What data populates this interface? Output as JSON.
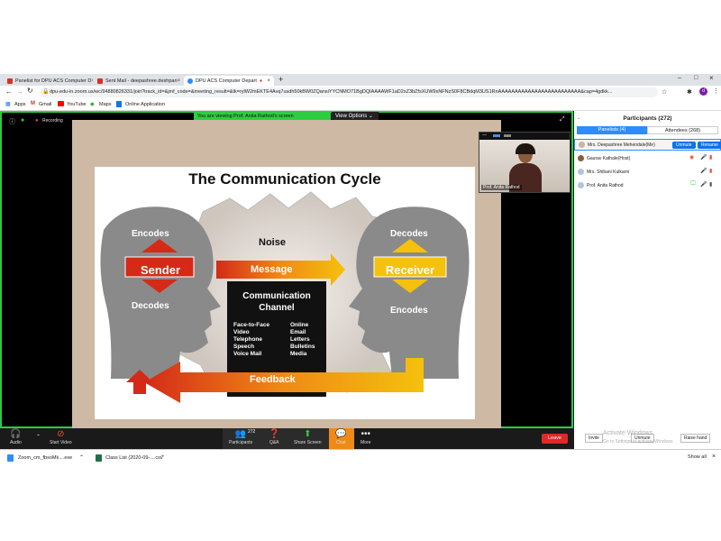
{
  "browser": {
    "tabs": [
      {
        "label": "Panelist for DPU ACS Computer D",
        "color": "#d93025"
      },
      {
        "label": "Sent Mail - deepashree.deshpan",
        "color": "#d93025"
      },
      {
        "label": "DPU ACS Computer Depart",
        "color": "#2d8cff"
      }
    ],
    "url": "dpu-edu-in.zoom.us/wc/94880826331/join?track_id=&jmf_code=&meeting_result=&tk=rylW2mEKTE4Avq7usdh50kBW0ZQansiYYCNMO71BgDQIAAAAWF1aD2xZ3bZfsXUW9sNFNzS0F8CBdqM3US1RnAAAAAAAAAAAAAAAAAAAAAAAAA&cap=4gdkk...",
    "bookmarks": [
      "Apps",
      "Gmail",
      "YouTube",
      "Maps",
      "Online Application"
    ]
  },
  "zoom": {
    "banner": "You are viewing Prof. Anita Rathod's screen",
    "view_options": "View Options",
    "recording": "Recording",
    "speaker_name": "Prof. Anita Rathod",
    "toolbar": {
      "audio": "Audio",
      "stop_video": "Start Video",
      "participants": "Participants",
      "participants_count": "272",
      "qa": "Q&A",
      "share_screen": "Share Screen",
      "chat": "Chat",
      "more": "More",
      "leave": "Leave"
    },
    "panel": {
      "title": "Participants (272)",
      "tab_panelists": "Panelists (4)",
      "tab_attendees": "Attendees (268)",
      "people": [
        {
          "name": "Mrs. Deepashree Mehendale(Me)"
        },
        {
          "name": "Gaurav Kathale(Host)"
        },
        {
          "name": "Mrs. Shibani Kulkarni"
        },
        {
          "name": "Prof. Anita Rathod"
        }
      ],
      "unmute": "Unmute",
      "rename": "Rename",
      "invite": "Invite",
      "unmute_all": "Unmute",
      "raise_hand": "Raise hand",
      "activate_windows": "Activate Windows",
      "activate_sub": "Go to Settings to activate Windows."
    }
  },
  "slide": {
    "title": "The Communication Cycle",
    "noise": "Noise",
    "message": "Message",
    "sender": "Sender",
    "receiver": "Receiver",
    "encodes_left": "Encodes",
    "decodes_left": "Decodes",
    "decodes_right": "Decodes",
    "encodes_right": "Encodes",
    "channel_title": "Communication Channel",
    "channel_col1": [
      "Face-to-Face",
      "Video",
      "Telephone",
      "Speech",
      "Voice Mail"
    ],
    "channel_col2": [
      "Online",
      "Email",
      "Letters",
      "Bulletins",
      "Media"
    ],
    "feedback": "Feedback"
  },
  "taskbar": {
    "items": [
      "Zoom_cm_fbsoMk....exe",
      "Class List (2020-09-....csv"
    ],
    "show_all": "Show all"
  }
}
